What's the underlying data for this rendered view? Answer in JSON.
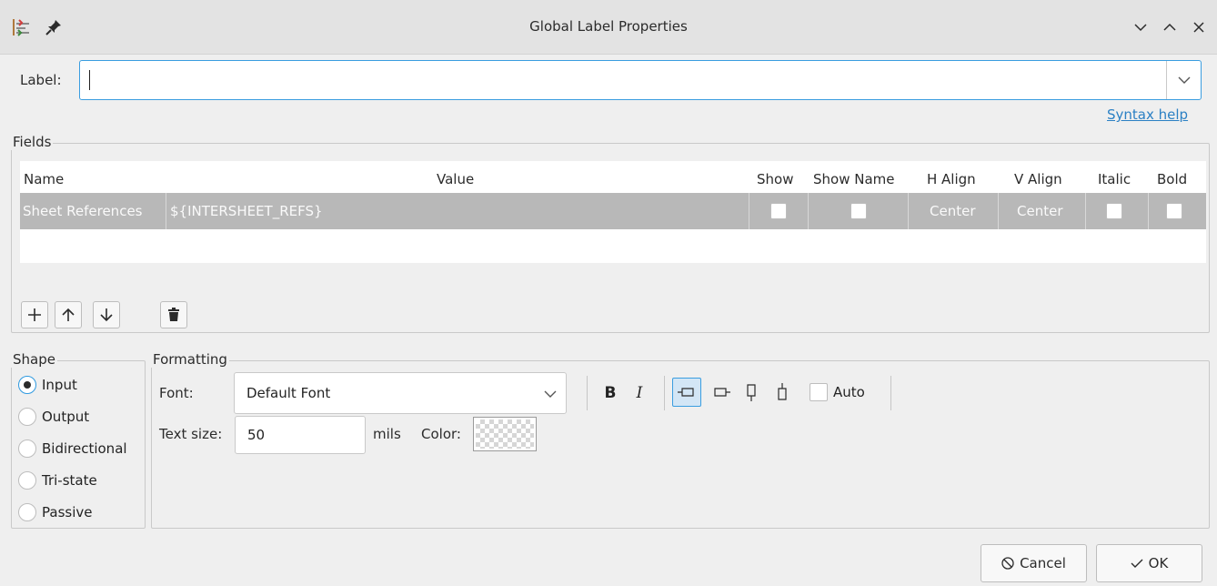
{
  "window": {
    "title": "Global Label Properties",
    "app_icon": "kicad-schematic-icon",
    "pin_icon": "pin-icon",
    "controls": [
      "minimize",
      "maximize",
      "close"
    ]
  },
  "label_row": {
    "label": "Label:",
    "value": "",
    "syntax_help": "Syntax help"
  },
  "fields": {
    "title": "Fields",
    "columns": {
      "name": "Name",
      "value": "Value",
      "show": "Show",
      "show_name": "Show Name",
      "h_align": "H Align",
      "v_align": "V Align",
      "italic": "Italic",
      "bold": "Bold"
    },
    "rows": [
      {
        "name": "Sheet References",
        "value": "${INTERSHEET_REFS}",
        "show": false,
        "show_name": false,
        "h_align": "Center",
        "v_align": "Center",
        "italic": false,
        "bold": false
      }
    ],
    "toolbar": [
      "add-icon",
      "move-up-icon",
      "move-down-icon",
      "delete-icon"
    ]
  },
  "shape": {
    "title": "Shape",
    "options": [
      "Input",
      "Output",
      "Bidirectional",
      "Tri-state",
      "Passive"
    ],
    "selected": "Input"
  },
  "formatting": {
    "title": "Formatting",
    "font_label": "Font:",
    "font_value": "Default Font",
    "bold_label": "B",
    "italic_label": "I",
    "orientation_icons": [
      "orient-right-icon",
      "orient-left-icon",
      "orient-up-icon",
      "orient-down-icon"
    ],
    "auto_label": "Auto",
    "auto_checked": false,
    "text_size_label": "Text size:",
    "text_size_value": "50",
    "text_size_unit": "mils",
    "color_label": "Color:"
  },
  "buttons": {
    "cancel": "Cancel",
    "ok": "OK"
  },
  "colors": {
    "accent": "#3a9de0",
    "link": "#2b80c4",
    "selected_row": "#b8b8b8"
  }
}
